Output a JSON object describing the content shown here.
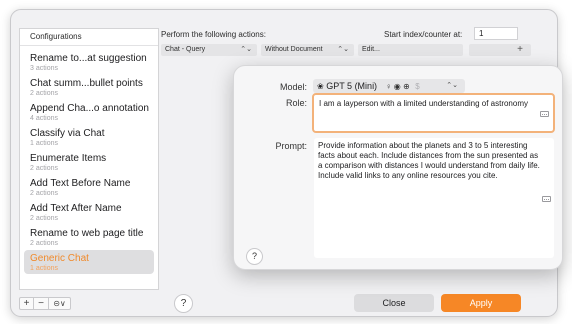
{
  "sidebar": {
    "header": "Configurations",
    "items": [
      {
        "name": "Rename to...at suggestion",
        "sub": "3 actions"
      },
      {
        "name": "Chat summ...bullet points",
        "sub": "2 actions"
      },
      {
        "name": "Append Cha...o annotation",
        "sub": "4 actions"
      },
      {
        "name": "Classify via Chat",
        "sub": "1 actions"
      },
      {
        "name": "Enumerate Items",
        "sub": "2 actions"
      },
      {
        "name": "Add Text Before Name",
        "sub": "2 actions"
      },
      {
        "name": "Add Text After Name",
        "sub": "2 actions"
      },
      {
        "name": "Rename to web page title",
        "sub": "2 actions"
      },
      {
        "name": "Generic Chat",
        "sub": "1 actions",
        "selected": true
      }
    ],
    "footer": {
      "add": "+",
      "remove": "−",
      "gear": "⊝∨"
    }
  },
  "toolbar": {
    "actions_label": "Perform the following actions:",
    "start_label": "Start index/counter at:",
    "start_value": "1"
  },
  "action_row": {
    "action": "Chat - Query",
    "document": "Without Document",
    "edit": "Edit...",
    "add": "+"
  },
  "popover": {
    "model_label": "Model:",
    "model_value": "GPT 5 (Mini)",
    "model_caps": "♀ ◉ ⊕",
    "model_price": "$",
    "role_label": "Role:",
    "role_value": "I am a layperson with a limited understanding of astronomy",
    "prompt_label": "Prompt:",
    "prompt_value": "Provide information about the planets and 3 to 5 interesting facts about each. Include distances from the sun presented as a comparison with distances I would understand from daily life. Include valid links to any online resources you cite.",
    "help": "?"
  },
  "buttons": {
    "help": "?",
    "close": "Close",
    "apply": "Apply"
  },
  "colors": {
    "accent": "#f68726",
    "selected_text": "#f08a2c",
    "focus_ring": "#f3b27a"
  },
  "icons": {
    "chevron": "updown-chevron-icon",
    "keyboard": "keyboard-icon",
    "model": "openai-icon"
  }
}
